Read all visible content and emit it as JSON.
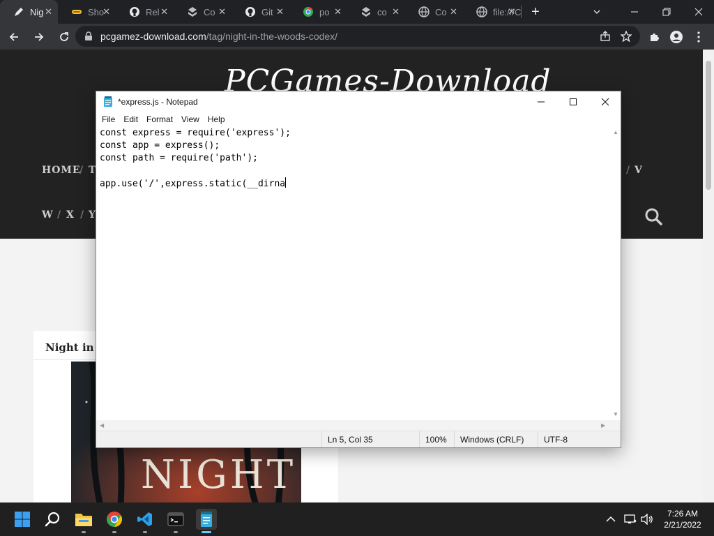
{
  "browser": {
    "tabs": [
      {
        "label": "Nig",
        "icon": "pen-icon",
        "active": true
      },
      {
        "label": "Sho",
        "icon": "hotdog-icon",
        "active": false
      },
      {
        "label": "Rel",
        "icon": "github-icon",
        "active": false
      },
      {
        "label": "Co",
        "icon": "inbox-icon",
        "active": false
      },
      {
        "label": "Git",
        "icon": "github-icon",
        "active": false
      },
      {
        "label": "po",
        "icon": "chrome-icon",
        "active": false
      },
      {
        "label": "co",
        "icon": "inbox-icon",
        "active": false
      },
      {
        "label": "Co",
        "icon": "globe-icon",
        "active": false
      },
      {
        "label": "file:///C",
        "icon": "globe-icon",
        "active": false
      }
    ],
    "new_tab": "+",
    "url_host": "pcgamez-download.com",
    "url_path": "/tag/night-in-the-woods-codex/"
  },
  "site": {
    "logo": "PCGames-Download",
    "nav_row1_left": [
      "HOME",
      "/",
      "T"
    ],
    "nav_row1_right": [
      "/",
      "V"
    ],
    "nav_row2": [
      "W",
      "/",
      "X",
      "/",
      "Y"
    ],
    "post_title": "Night in th",
    "post_image_text": "NIGHT"
  },
  "notepad": {
    "title": "*express.js - Notepad",
    "menu": [
      "File",
      "Edit",
      "Format",
      "View",
      "Help"
    ],
    "lines": [
      "const express = require('express');",
      "const app = express();",
      "const path = require('path');",
      "",
      "app.use('/',express.static(__dirna"
    ],
    "status": {
      "position": "Ln 5, Col 35",
      "zoom": "100%",
      "line_ending": "Windows (CRLF)",
      "encoding": "UTF-8"
    }
  },
  "taskbar": {
    "apps": [
      "windows-start-icon",
      "search-icon",
      "file-explorer-icon",
      "chrome-icon",
      "vscode-icon",
      "terminal-icon",
      "notepad-icon"
    ],
    "time": "7:26 AM",
    "date": "2/21/2022"
  },
  "colors": {
    "chrome_dark": "#202124",
    "chrome_toolbar": "#35363a",
    "site_header": "#222222",
    "taskbar": "#202020",
    "accent_blue": "#60cdff"
  }
}
